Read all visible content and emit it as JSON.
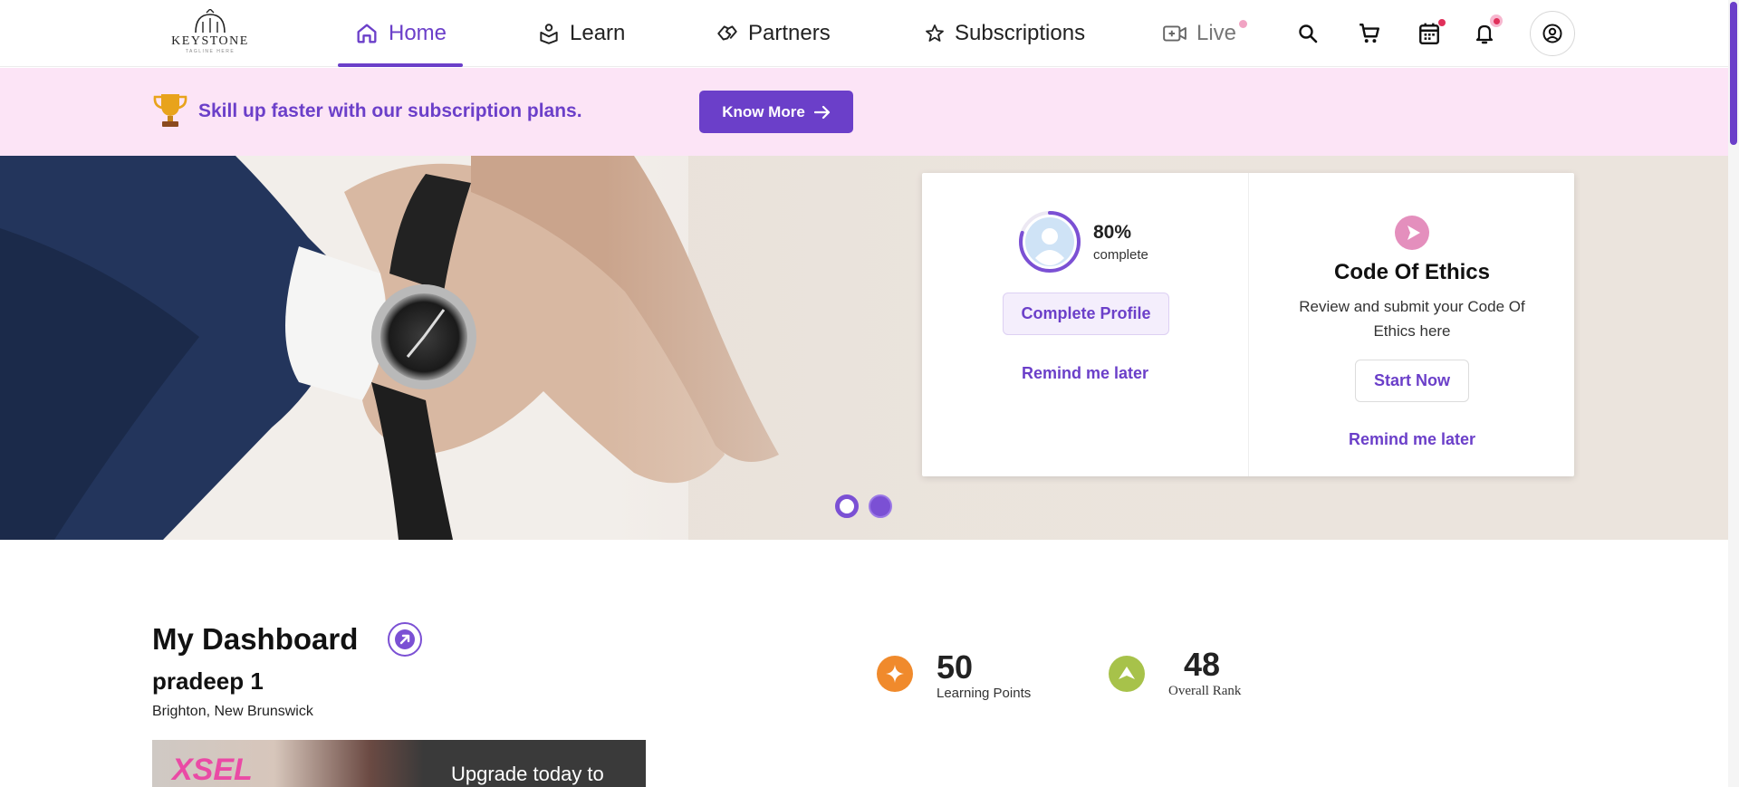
{
  "logo": {
    "name": "KEYSTONE",
    "tagline": "TAGLINE HERE"
  },
  "nav": {
    "items": [
      {
        "label": "Home",
        "icon": "home-icon",
        "active": true
      },
      {
        "label": "Learn",
        "icon": "learn-icon"
      },
      {
        "label": "Partners",
        "icon": "handshake-icon"
      },
      {
        "label": "Subscriptions",
        "icon": "star-icon"
      },
      {
        "label": "Live",
        "icon": "video-icon"
      }
    ],
    "icons": [
      "search-icon",
      "cart-icon",
      "calendar-icon",
      "bell-icon",
      "account-icon"
    ]
  },
  "promo": {
    "text": "Skill up faster with our subscription plans.",
    "button": "Know More"
  },
  "hero": {
    "profile_card": {
      "percent": "80%",
      "percent_value": 0.8,
      "percent_label": "complete",
      "button": "Complete Profile",
      "remind": "Remind me later"
    },
    "ethics_card": {
      "title": "Code Of Ethics",
      "description": "Review and submit your Code Of Ethics here",
      "button": "Start Now",
      "remind": "Remind me later"
    },
    "slides": 2
  },
  "dashboard": {
    "title": "My Dashboard",
    "user_name": "pradeep 1",
    "location": "Brighton, New Brunswick",
    "upgrade_text": "Upgrade today to",
    "upgrade_logo": "XSEL",
    "stats": [
      {
        "value": "50",
        "label": "Learning Points",
        "color": "#f08a2c"
      },
      {
        "value": "48",
        "label": "Overall Rank",
        "color": "#a7c24a"
      }
    ]
  },
  "colors": {
    "accent": "#6b3fc9",
    "promo_bg": "#fce4f6"
  }
}
